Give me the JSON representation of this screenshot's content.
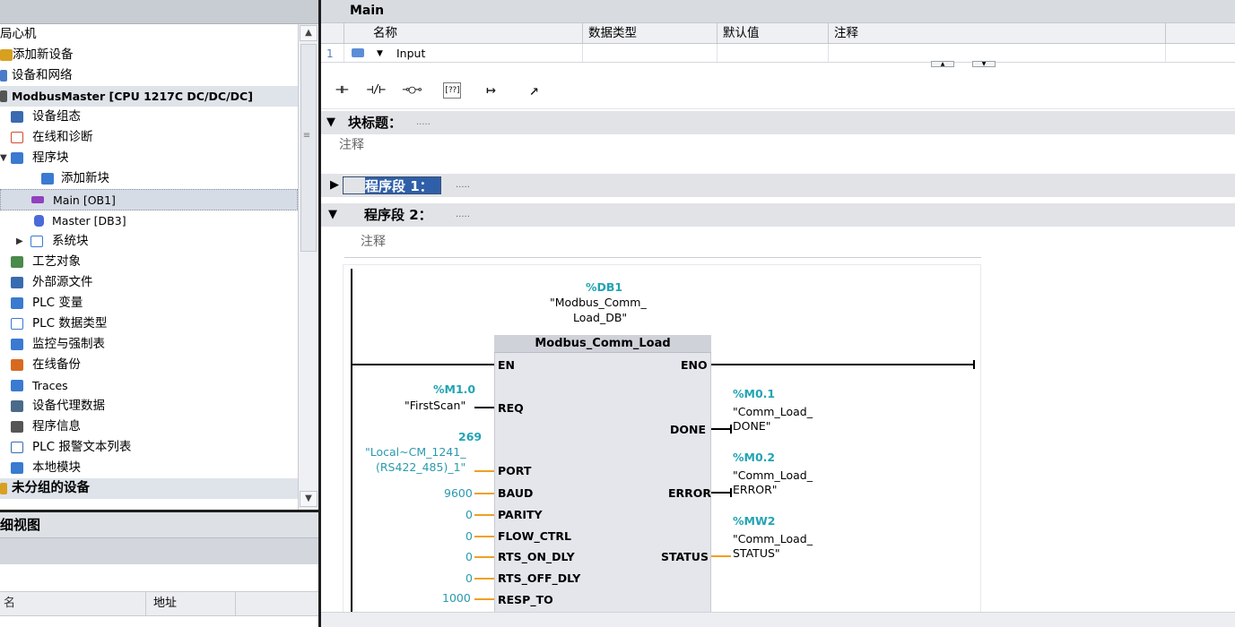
{
  "tree": {
    "items": [
      {
        "label": "设备和网络",
        "color": "#4a7ac8"
      },
      {
        "label": "ModbusMaster [CPU 1217C DC/DC/DC]",
        "color": "#555"
      },
      {
        "label": "设备组态",
        "color": "#3a6ab0"
      },
      {
        "label": "在线和诊断",
        "color": "#d24a30"
      },
      {
        "label": "程序块",
        "color": "#3a7ad0"
      },
      {
        "label": "添加新块",
        "color": "#3a7ad0"
      },
      {
        "label": "Main [OB1]",
        "color": "#9040c0"
      },
      {
        "label": "Master [DB3]",
        "color": "#4a6ad8"
      },
      {
        "label": "系统块",
        "color": "#3a7ad0"
      },
      {
        "label": "工艺对象",
        "color": "#4a8a4a"
      },
      {
        "label": "外部源文件",
        "color": "#3a6ab0"
      },
      {
        "label": "PLC 变量",
        "color": "#3a7ad0"
      },
      {
        "label": "PLC 数据类型",
        "color": "#3a7ad0"
      },
      {
        "label": "监控与强制表",
        "color": "#3a7ad0"
      },
      {
        "label": "在线备份",
        "color": "#d86a20"
      },
      {
        "label": "Traces",
        "color": "#3a7ad0"
      },
      {
        "label": "设备代理数据",
        "color": "#4a6a8a"
      },
      {
        "label": "程序信息",
        "color": "#555"
      },
      {
        "label": "PLC 报警文本列表",
        "color": "#3a6ab0"
      },
      {
        "label": "本地模块",
        "color": "#3a7ad0"
      },
      {
        "label": "未分组的设备",
        "color": "#d8a020"
      }
    ],
    "top_items": [
      {
        "label": "添加新设备",
        "color": "#d8a020"
      }
    ],
    "header_item": "局心机"
  },
  "detail": {
    "title": "细视图",
    "col_name": "名",
    "col_address": "地址"
  },
  "interface": {
    "title": "Main",
    "columns": [
      "名称",
      "数据类型",
      "默认值",
      "注释"
    ],
    "row": {
      "num": "1",
      "name": "Input"
    }
  },
  "toolbar": {
    "buttons": [
      "⊣⊢",
      "⊣/⊢",
      "⊸○⊸",
      "[??]",
      "↦",
      "↗"
    ]
  },
  "block": {
    "title": "块标题：",
    "dots": ".....",
    "comment": "注释"
  },
  "networks": [
    {
      "title": "程序段 1：",
      "dots": "....."
    },
    {
      "title": "程序段 2：",
      "dots": "....."
    }
  ],
  "network2": {
    "comment": "注释",
    "fb": {
      "db_addr": "%DB1",
      "db_name_1": "\"Modbus_Comm_",
      "db_name_2": "Load_DB\"",
      "title": "Modbus_Comm_Load",
      "en": "EN",
      "eno": "ENO",
      "inputs": [
        "REQ",
        "PORT",
        "BAUD",
        "PARITY",
        "FLOW_CTRL",
        "RTS_ON_DLY",
        "RTS_OFF_DLY",
        "RESP_TO"
      ],
      "outputs": [
        "DONE",
        "ERROR",
        "STATUS"
      ],
      "req_addr": "%M1.0",
      "req_name": "\"FirstScan\"",
      "port_val": "269",
      "port_name_1": "\"Local~CM_1241_",
      "port_name_2": "(RS422_485)_1\"",
      "baud": "9600",
      "parity": "0",
      "flow": "0",
      "rts_on": "0",
      "rts_off": "0",
      "resp_to": "1000",
      "done_addr": "%M0.1",
      "done_name_1": "\"Comm_Load_",
      "done_name_2": "DONE\"",
      "err_addr": "%M0.2",
      "err_name_1": "\"Comm_Load_",
      "err_name_2": "ERROR\"",
      "status_addr": "%MW2",
      "status_name_1": "\"Comm_Load_",
      "status_name_2": "STATUS\""
    }
  },
  "colors": {
    "accent": "#2f5fa8",
    "teal": "#22a4b4",
    "orange": "#f0a020"
  }
}
